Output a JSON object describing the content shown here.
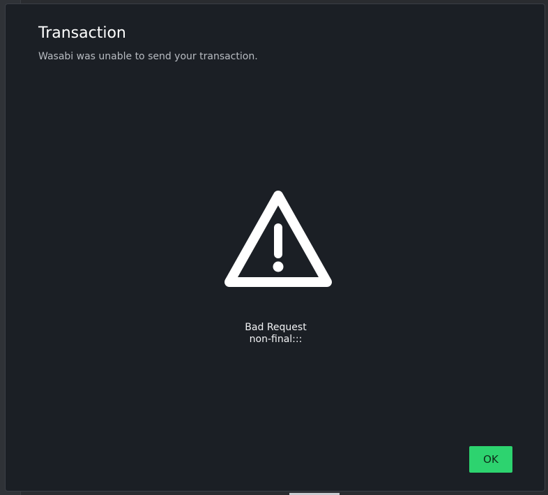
{
  "dialog": {
    "title": "Transaction",
    "subtitle": "Wasabi was unable to send your transaction.",
    "icon": "warning-triangle-icon",
    "message_line1": "Bad Request",
    "message_line2": "non-final:::",
    "ok_label": "OK"
  },
  "colors": {
    "dialog_bg": "#1b1f25",
    "accent": "#2dd36f",
    "text_primary": "#ffffff",
    "text_secondary": "#b8bcc2"
  }
}
